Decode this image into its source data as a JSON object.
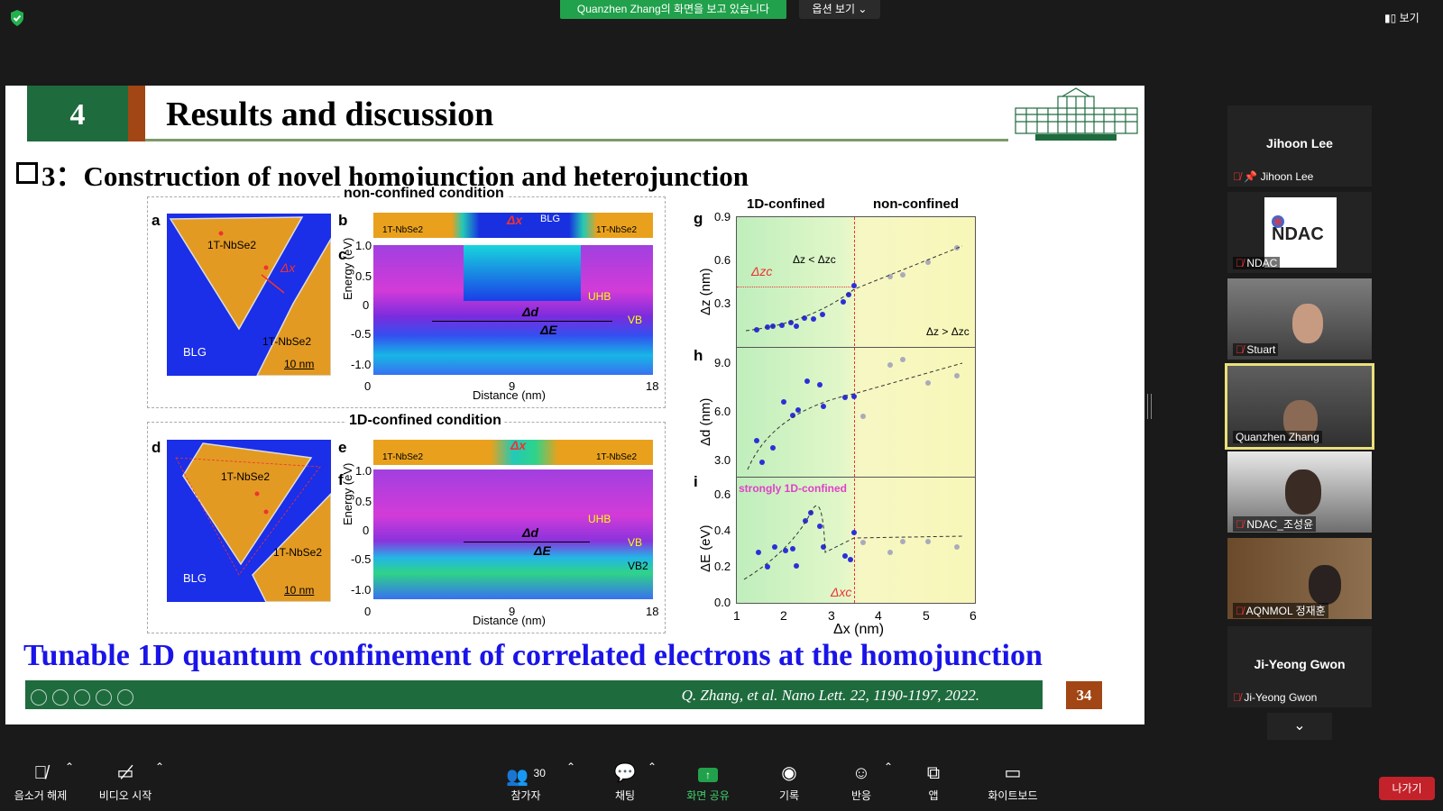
{
  "top_bar": {
    "share_banner": "Quanzhen  Zhang의 화면을 보고 있습니다",
    "view_options": "옵션 보기",
    "view_label": "보기"
  },
  "slide": {
    "section_number": "4",
    "title": "Results and discussion",
    "subtitle": "3：Construction of novel homojunction and heterojunction",
    "top_condition": "non-confined condition",
    "bottom_condition": "1D-confined condition",
    "panel_labels": [
      "a",
      "b",
      "c",
      "d",
      "e",
      "f",
      "g",
      "h",
      "i"
    ],
    "sample_labels": {
      "nbse2": "1T-NbSe2",
      "blg": "BLG",
      "scale": "10 nm",
      "uhb": "UHB",
      "vb": "VB",
      "vb2": "VB2",
      "delta_x": "Δx",
      "delta_d": "Δd",
      "delta_e": "ΔE"
    },
    "energy_axis": {
      "label": "Energy (eV)",
      "ticks": [
        "1.0",
        "0.5",
        "0",
        "-0.5",
        "-1.0"
      ]
    },
    "distance_axis": {
      "label": "Distance (nm)",
      "ticks": [
        "0",
        "9",
        "18"
      ]
    },
    "right_plot": {
      "col_left": "1D-confined",
      "col_right": "non-confined",
      "g": {
        "ylabel": "Δz (nm)",
        "ticks": [
          "0.9",
          "0.6",
          "0.3"
        ],
        "annot_left": "Δz < Δzc",
        "annot_right": "Δz > Δzc",
        "threshold": "Δzc"
      },
      "h": {
        "ylabel": "Δd (nm)",
        "ticks": [
          "9.0",
          "6.0",
          "3.0"
        ]
      },
      "i": {
        "ylabel": "ΔE (eV)",
        "ticks": [
          "0.6",
          "0.4",
          "0.2",
          "0.0"
        ],
        "annot": "strongly 1D-confined",
        "threshold": "Δxc"
      },
      "xlabel": "Δx (nm)",
      "xticks": [
        "1",
        "2",
        "3",
        "4",
        "5",
        "6"
      ]
    },
    "conclusion": "Tunable 1D quantum confinement of correlated electrons at the homojunction",
    "footer_ref": "Q. Zhang, et al. Nano Lett. 22, 1190-1197, 2022.",
    "page_number": "34"
  },
  "participants": [
    {
      "name": "Jihoon Lee",
      "label": "Jihoon Lee",
      "video": false
    },
    {
      "name": "NDAC",
      "label": "NDAC",
      "video": true
    },
    {
      "name": "Stuart",
      "label": "Stuart",
      "video": true
    },
    {
      "name": "Quanzhen Zhang",
      "label": "Quanzhen Zhang",
      "video": true,
      "active": true
    },
    {
      "name": "NDAC_조성윤",
      "label": "NDAC_조성윤",
      "video": true
    },
    {
      "name": "AQNMOL 정재훈",
      "label": "AQNMOL 정재훈",
      "video": true
    },
    {
      "name": "Ji-Yeong Gwon",
      "label": "Ji-Yeong Gwon",
      "video": false
    }
  ],
  "ndac_logo_text": "NDAC",
  "toolbar": {
    "unmute": "음소거 해제",
    "start_video": "비디오 시작",
    "participants": "참가자",
    "participants_count": "30",
    "chat": "채팅",
    "share_screen": "화면 공유",
    "record": "기록",
    "reactions": "반응",
    "apps": "앱",
    "whiteboard": "화이트보드",
    "leave": "나가기"
  }
}
